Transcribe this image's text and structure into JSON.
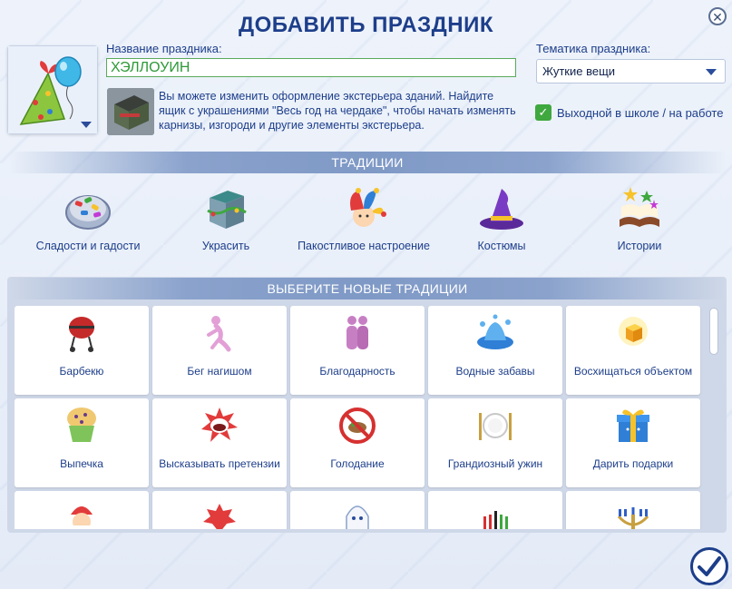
{
  "dialog": {
    "title": "ДОБАВИТЬ ПРАЗДНИК",
    "close_icon": "close-icon"
  },
  "holiday_name": {
    "label": "Название праздника:",
    "value": "ХЭЛЛОУИН"
  },
  "hint": {
    "text": "Вы можете изменить оформление экстерьера зданий. Найдите ящик с украшениями \"Весь год на чердаке\", чтобы начать изменять карнизы, изгороди и другие элементы экстерьера."
  },
  "theme": {
    "label": "Тематика праздника:",
    "selected": "Жуткие вещи"
  },
  "day_off": {
    "label": "Выходной в школе / на работе",
    "checked": true
  },
  "traditions": {
    "header": "ТРАДИЦИИ",
    "items": [
      {
        "label": "Сладости и гадости",
        "icon": "candy-bowl-icon"
      },
      {
        "label": "Украсить",
        "icon": "decoration-box-icon"
      },
      {
        "label": "Пакостливое настроение",
        "icon": "jester-hat-icon"
      },
      {
        "label": "Костюмы",
        "icon": "witch-hat-icon"
      },
      {
        "label": "Истории",
        "icon": "story-book-icon"
      }
    ]
  },
  "new_traditions": {
    "header": "ВЫБЕРИТЕ НОВЫЕ ТРАДИЦИИ",
    "items": [
      {
        "label": "Барбекю",
        "icon": "grill-icon"
      },
      {
        "label": "Бег нагишом",
        "icon": "streaker-icon"
      },
      {
        "label": "Благодарность",
        "icon": "hugging-people-icon"
      },
      {
        "label": "Водные забавы",
        "icon": "water-splash-icon"
      },
      {
        "label": "Восхищаться объектом",
        "icon": "glowing-cube-icon"
      },
      {
        "label": "Выпечка",
        "icon": "muffin-icon"
      },
      {
        "label": "Высказывать претензии",
        "icon": "shouting-mouth-icon"
      },
      {
        "label": "Голодание",
        "icon": "no-food-icon"
      },
      {
        "label": "Грандиозный ужин",
        "icon": "dinner-plate-icon"
      },
      {
        "label": "Дарить подарки",
        "icon": "gift-box-icon"
      },
      {
        "label": "",
        "icon": "santa-icon"
      },
      {
        "label": "",
        "icon": "red-creature-icon"
      },
      {
        "label": "",
        "icon": "ghost-icon"
      },
      {
        "label": "",
        "icon": "kinara-icon"
      },
      {
        "label": "",
        "icon": "menorah-icon"
      }
    ]
  },
  "confirm_icon": "checkmark-icon",
  "colors": {
    "accent": "#1d3e8a",
    "input_text": "#2e9a38",
    "checkbox": "#3fa83f",
    "band": "#7f99c6"
  }
}
